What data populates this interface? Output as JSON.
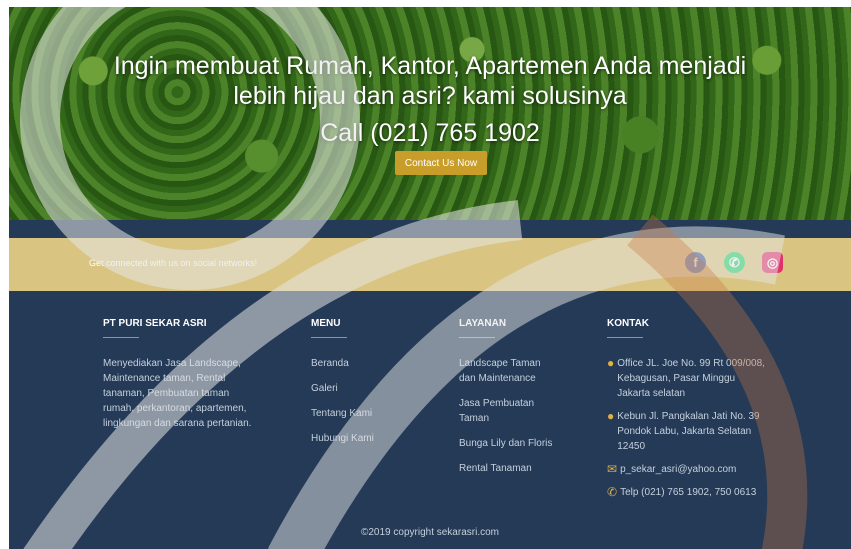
{
  "hero": {
    "line1": "Ingin membuat Rumah, Kantor, Apartemen Anda menjadi",
    "line2": "lebih hijau dan asri? kami solusinya",
    "call": "Call (021) 765 1902",
    "cta_label": "Contact Us Now"
  },
  "social": {
    "text": "Get connected with us on social networks!",
    "icons": [
      "facebook-icon",
      "whatsapp-icon",
      "instagram-icon"
    ]
  },
  "company": {
    "heading": "PT PURI SEKAR ASRI",
    "description": "Menyediakan Jasa Landscape, Maintenance taman, Rental tanaman, Pembuatan taman rumah, perkantoran, apartemen, lingkungan dan sarana pertanian."
  },
  "menu": {
    "heading": "MENU",
    "items": [
      "Beranda",
      "Galeri",
      "Tentang Kami",
      "Hubungi Kami"
    ]
  },
  "layanan": {
    "heading": "LAYANAN",
    "items": [
      "Landscape Taman dan Maintenance",
      "Jasa Pembuatan Taman",
      "Bunga Lily dan Floris",
      "Rental Tanaman"
    ]
  },
  "kontak": {
    "heading": "KONTAK",
    "office": "Office JL. Joe No. 99 Rt 009/008, Kebagusan, Pasar Minggu Jakarta selatan",
    "kebun": "Kebun Jl. Pangkalan Jati No. 39 Pondok Labu, Jakarta Selatan 12450",
    "email": "p_sekar_asri@yahoo.com",
    "telp": "Telp (021) 765 1902, 750 0613"
  },
  "footer": {
    "copyright": "©2019 copyright sekarasri.com"
  },
  "colors": {
    "accent": "#c99d2a",
    "band": "#d9c581",
    "footer_bg": "#243a57"
  }
}
